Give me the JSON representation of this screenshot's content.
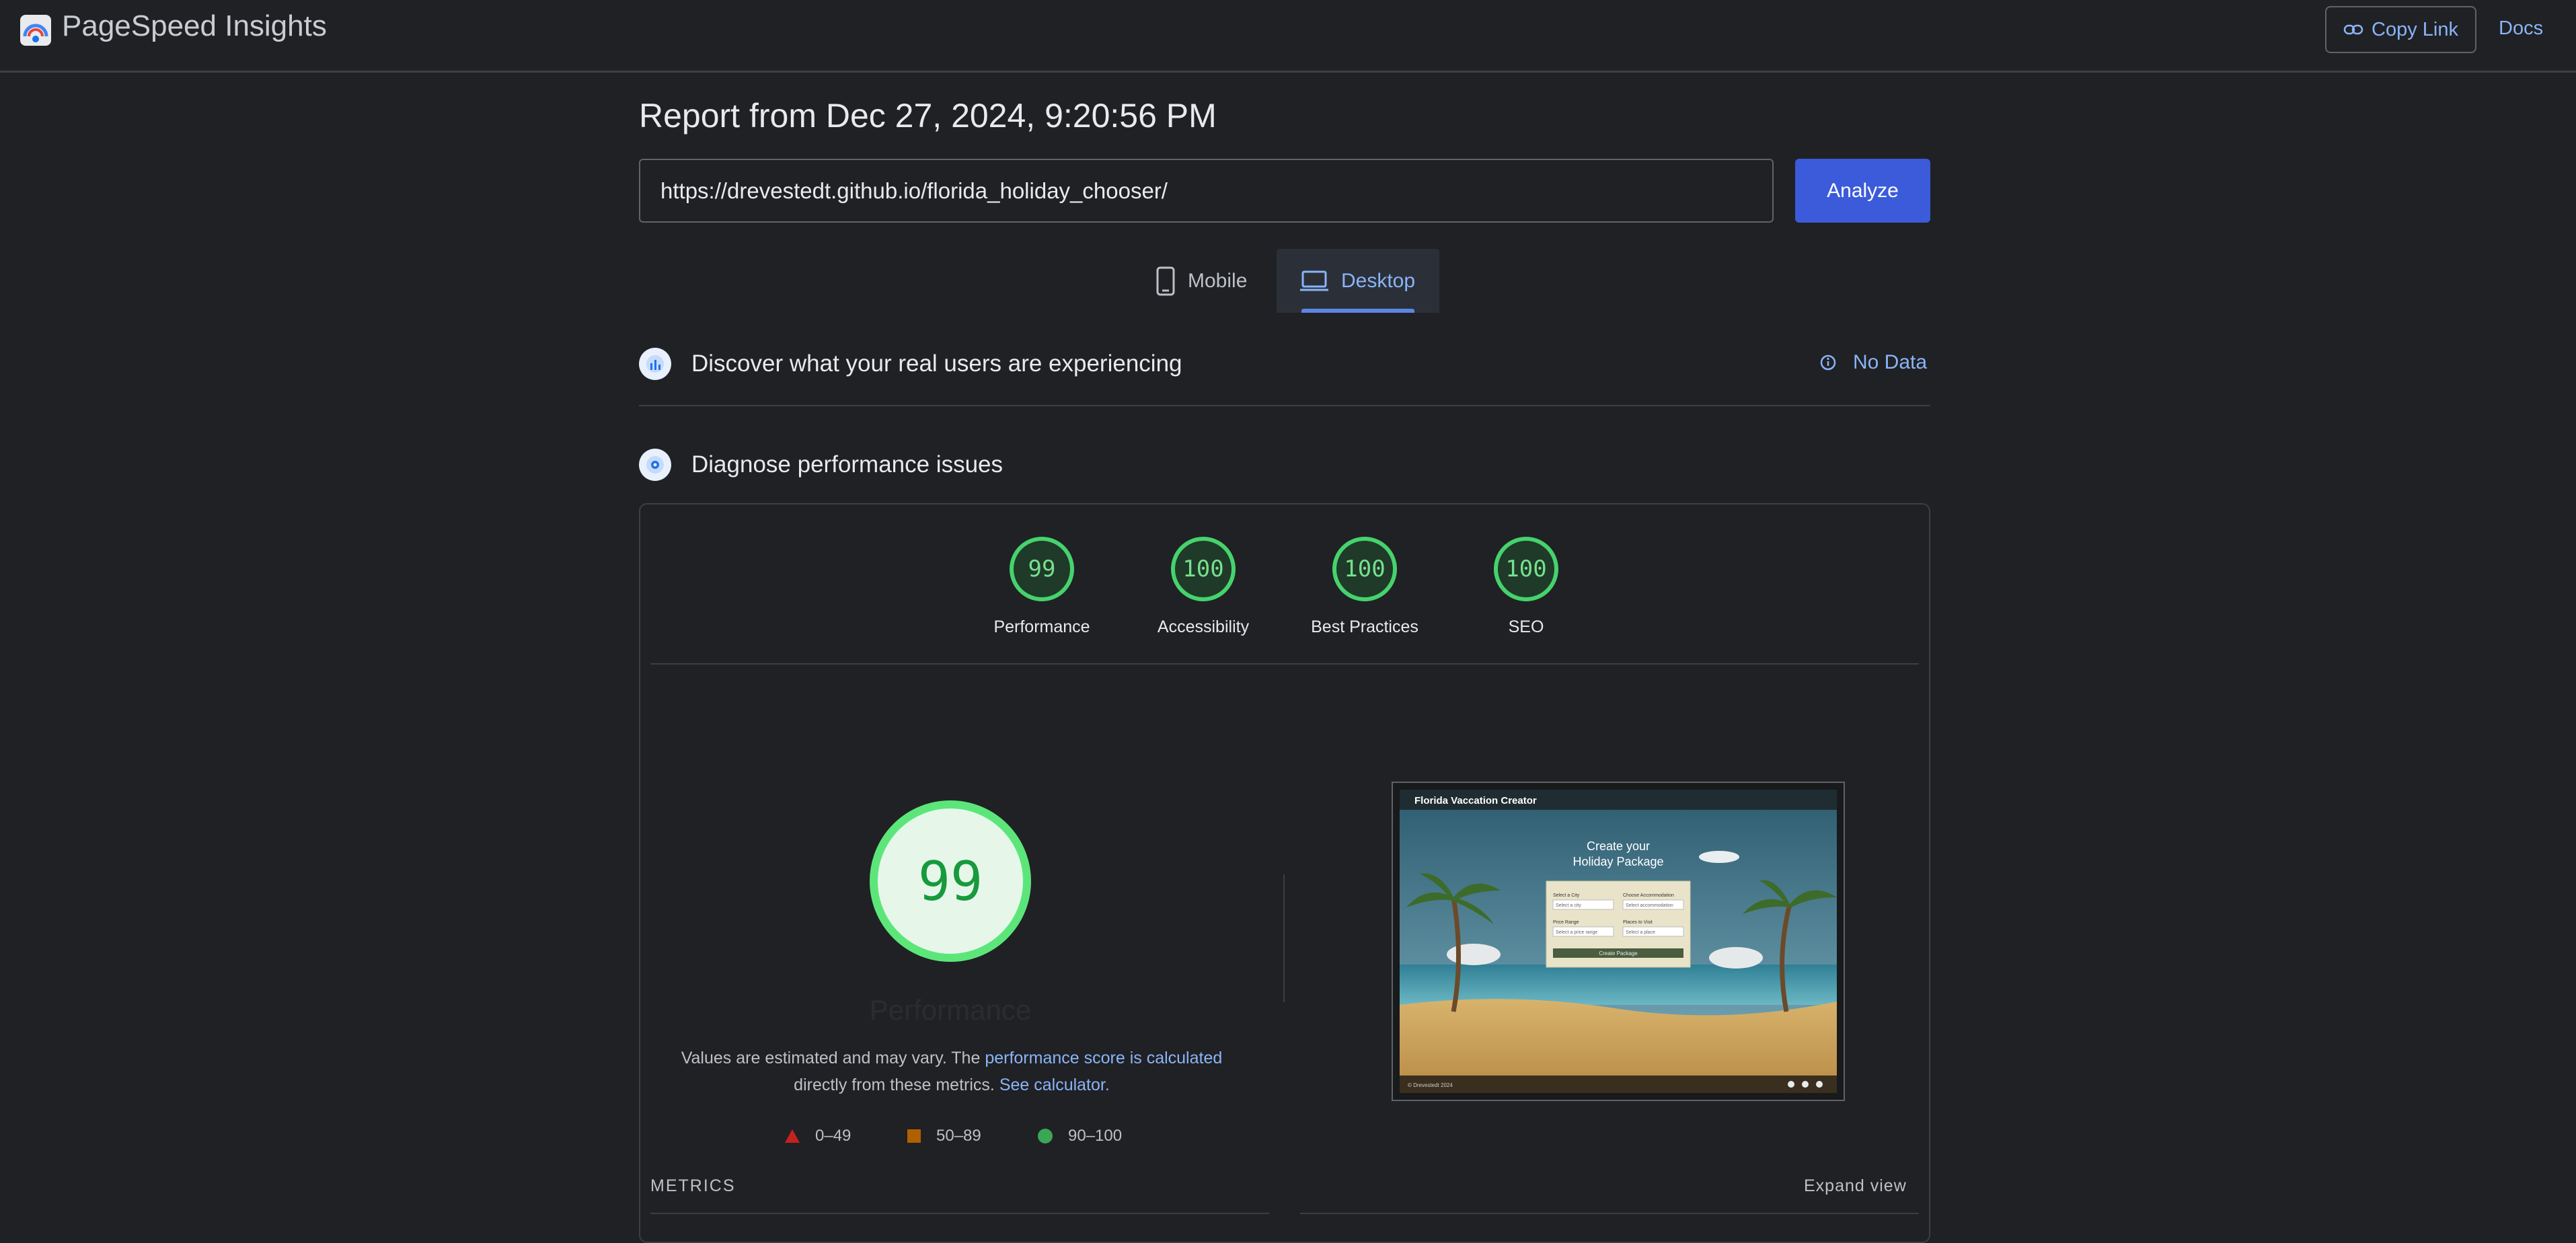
{
  "app": {
    "title": "PageSpeed Insights"
  },
  "header": {
    "copy_link_label": "Copy Link",
    "docs_label": "Docs"
  },
  "report": {
    "title": "Report from Dec 27, 2024, 9:20:56 PM"
  },
  "search": {
    "url_value": "https://drevestedt.github.io/florida_holiday_chooser/",
    "analyze_label": "Analyze"
  },
  "device_tabs": [
    {
      "label": "Mobile",
      "selected": false
    },
    {
      "label": "Desktop",
      "selected": true
    }
  ],
  "field_data": {
    "heading": "Discover what your real users are experiencing",
    "status": "No Data"
  },
  "lab": {
    "heading": "Diagnose performance issues",
    "scores": [
      {
        "label": "Performance",
        "score": "99"
      },
      {
        "label": "Accessibility",
        "score": "100"
      },
      {
        "label": "Best Practices",
        "score": "100"
      },
      {
        "label": "SEO",
        "score": "100"
      }
    ],
    "main_score": "99",
    "main_label": "Performance",
    "note_prefix": "Values are estimated and may vary. The ",
    "note_link1": "performance score is calculated",
    "note_mid": "directly from these metrics. ",
    "note_link2": "See calculator.",
    "legend": [
      {
        "range": "0–49",
        "color": "#c5221f"
      },
      {
        "range": "50–89",
        "color": "#b06000"
      },
      {
        "range": "90–100",
        "color": "#3aa757"
      }
    ],
    "metrics_label": "METRICS",
    "expand_label": "Expand view"
  },
  "screenshot": {
    "site_title": "Florida Vaccation Creator",
    "hero_line1": "Create your",
    "hero_line2": "Holiday Package",
    "field1_label": "Select a City",
    "field1_value": "Select a city",
    "field2_label": "Choose Accommodation",
    "field2_value": "Select accommodation",
    "field3_label": "Price Range",
    "field3_value": "Select a price range",
    "field4_label": "Places to Visit",
    "field4_value": "Select a place",
    "button_label": "Create Package",
    "footer": "© Drevestedt 2024"
  },
  "colors": {
    "accent": "#8ab4f8",
    "good": "#46d26d",
    "analyze": "#3b5bdb",
    "background": "#202124"
  }
}
